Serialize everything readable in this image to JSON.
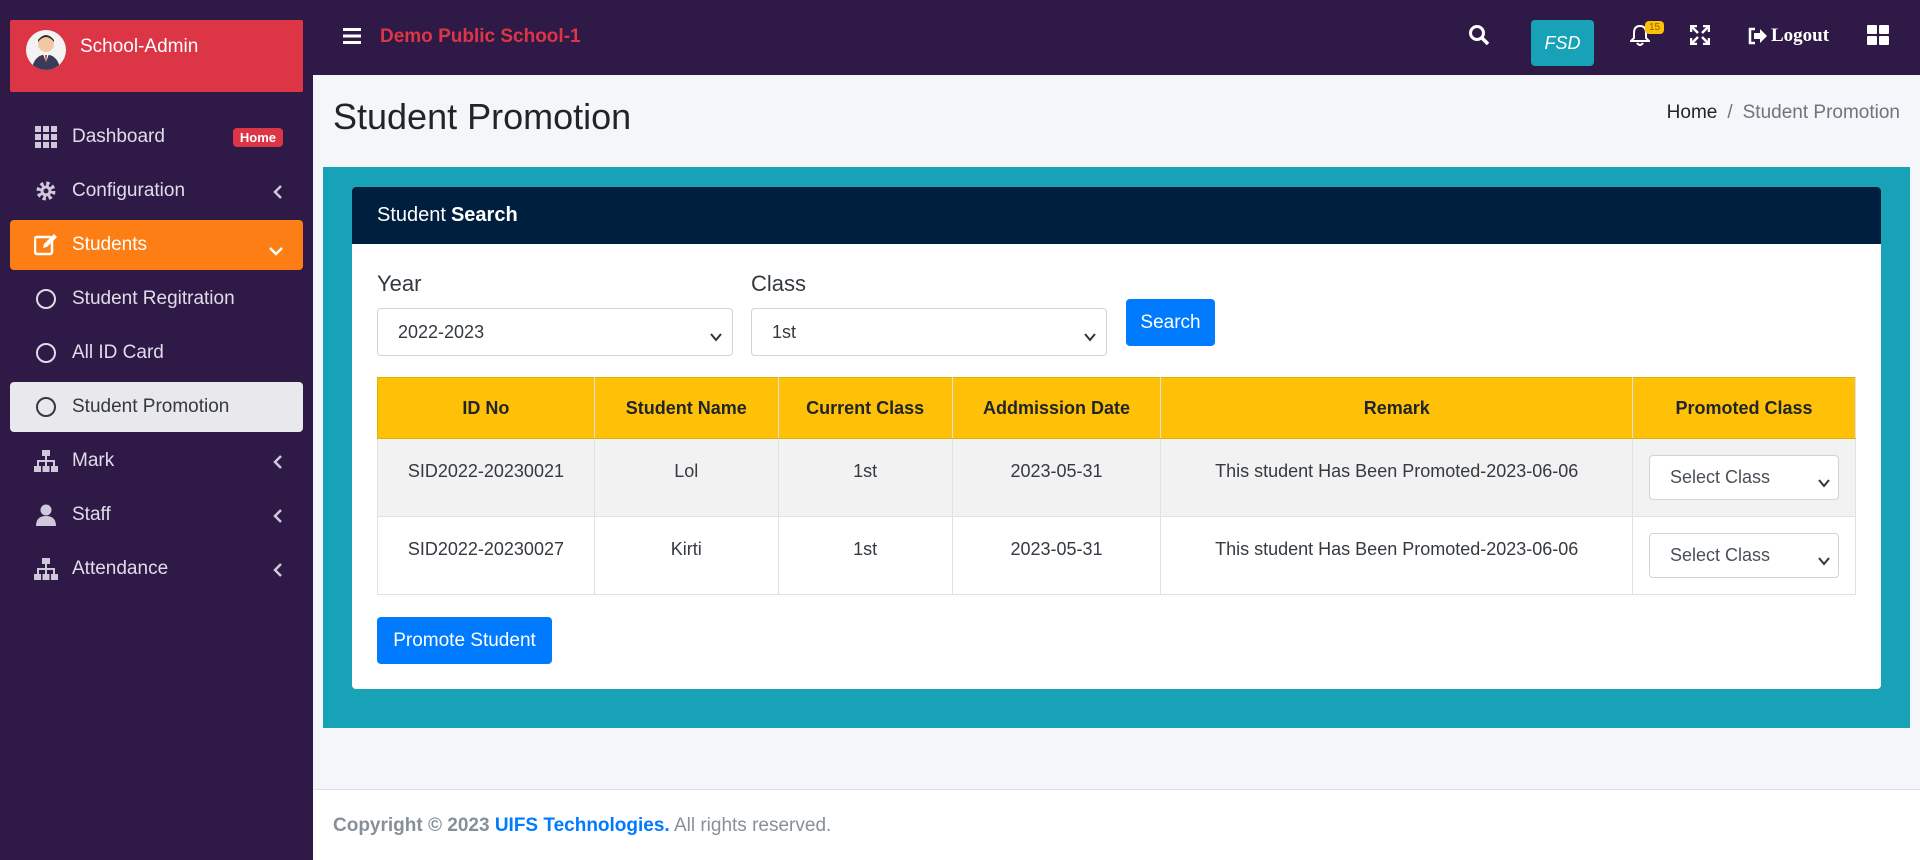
{
  "sidebar": {
    "brand": "School-Admin",
    "items": [
      {
        "label": "Dashboard",
        "badge": "Home"
      },
      {
        "label": "Configuration"
      },
      {
        "label": "Students"
      },
      {
        "label": "Student Regitration"
      },
      {
        "label": "All ID Card"
      },
      {
        "label": "Student Promotion"
      },
      {
        "label": "Mark"
      },
      {
        "label": "Staff"
      },
      {
        "label": "Attendance"
      }
    ]
  },
  "topbar": {
    "school_name": "Demo Public School-1",
    "fsd": "FSD",
    "notifications": "15",
    "logout": "Logout"
  },
  "page": {
    "title": "Student Promotion",
    "breadcrumb_home": "Home",
    "breadcrumb_sep": "/",
    "breadcrumb_current": "Student Promotion"
  },
  "card": {
    "header_normal": "Student",
    "header_bold": "Search",
    "year_label": "Year",
    "year_value": "2022-2023",
    "class_label": "Class",
    "class_value": "1st",
    "search_button": "Search",
    "promote_button": "Promote Student"
  },
  "table": {
    "headers": [
      "ID No",
      "Student Name",
      "Current Class",
      "Addmission Date",
      "Remark",
      "Promoted Class"
    ],
    "rows": [
      {
        "id": "SID2022-20230021",
        "name": "Lol",
        "class": "1st",
        "date": "2023-05-31",
        "remark": "This student Has Been Promoted-2023-06-06",
        "select": "Select Class"
      },
      {
        "id": "SID2022-20230027",
        "name": "Kirti",
        "class": "1st",
        "date": "2023-05-31",
        "remark": "This student Has Been Promoted-2023-06-06",
        "select": "Select Class"
      }
    ]
  },
  "footer": {
    "prefix": "Copyright © 2023",
    "company": "UIFS Technologies.",
    "suffix": "All rights reserved."
  },
  "colors": {
    "sidebar_bg": "#2f1a47",
    "brand_red": "#dc3545",
    "active_orange": "#fd7e14",
    "teal": "#17a2b8",
    "card_header": "#001f3f",
    "table_header": "#ffc107",
    "primary_blue": "#007bff"
  }
}
